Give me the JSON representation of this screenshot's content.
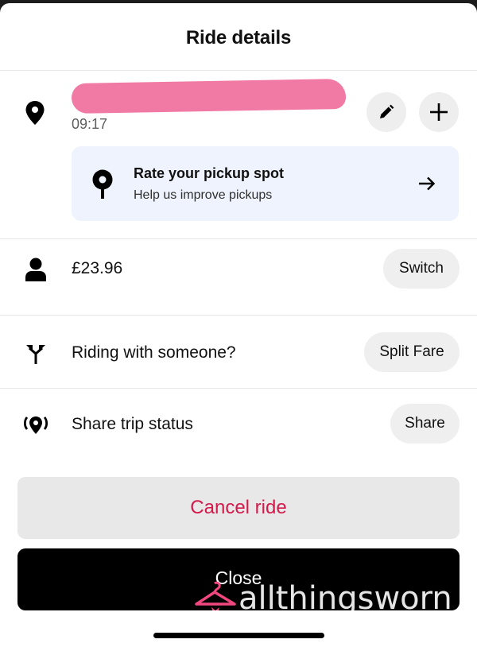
{
  "sheet": {
    "title": "Ride details"
  },
  "destination": {
    "time": "09:17",
    "edit_icon": "pencil-icon",
    "add_icon": "plus-icon",
    "pin_icon": "location-pin-icon"
  },
  "pickup_card": {
    "title": "Rate your pickup spot",
    "subtitle": "Help us improve pickups",
    "icon": "pickup-pin-icon",
    "arrow_icon": "arrow-right-icon"
  },
  "payment": {
    "amount": "£23.96",
    "button": "Switch",
    "icon": "person-icon"
  },
  "split": {
    "label": "Riding with someone?",
    "button": "Split Fare",
    "icon": "split-arrows-icon"
  },
  "share": {
    "label": "Share trip status",
    "button": "Share",
    "icon": "broadcast-location-icon"
  },
  "actions": {
    "cancel": "Cancel ride",
    "close": "Close"
  },
  "watermark": {
    "text": "allthingsworn"
  },
  "colors": {
    "cancel_text": "#d4194b",
    "card_bg": "#eef3fd",
    "redaction": "#f07aa3",
    "watermark": "#f0477f"
  }
}
